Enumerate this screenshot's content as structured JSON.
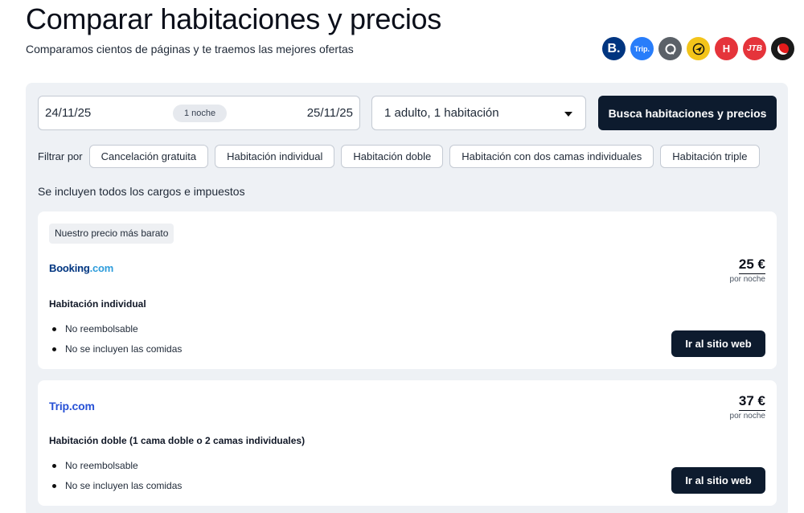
{
  "header": {
    "title": "Comparar habitaciones y precios",
    "subtitle": "Comparamos cientos de páginas y te traemos las mejores ofertas"
  },
  "partners": [
    {
      "name": "booking-logo-icon",
      "glyph": "B."
    },
    {
      "name": "trip-logo-icon",
      "glyph": "Trip."
    },
    {
      "name": "q-logo-icon",
      "glyph": "Q"
    },
    {
      "name": "plane-logo-icon",
      "glyph": "✈"
    },
    {
      "name": "h-logo-icon",
      "glyph": "H"
    },
    {
      "name": "jtb-logo-icon",
      "glyph": "JTB"
    },
    {
      "name": "dot-logo-icon",
      "glyph": ""
    }
  ],
  "search": {
    "date_start": "24/11/25",
    "nights": "1 noche",
    "date_end": "25/11/25",
    "guests": "1 adulto, 1 habitación",
    "button_label": "Busca habitaciones y precios"
  },
  "filters": {
    "label": "Filtrar por",
    "chips": [
      "Cancelación gratuita",
      "Habitación individual",
      "Habitación doble",
      "Habitación con dos camas individuales",
      "Habitación triple"
    ]
  },
  "tax_note": "Se incluyen todos los cargos e impuestos",
  "offers": [
    {
      "badge": "Nuestro precio más barato",
      "provider_main": "Booking",
      "provider_suffix": ".com",
      "price": "25 €",
      "price_unit": "por noche",
      "room": "Habitación individual",
      "features": [
        "No reembolsable",
        "No se incluyen las comidas"
      ],
      "button_label": "Ir al sitio web"
    },
    {
      "provider_main": "Trip.com",
      "price": "37 €",
      "price_unit": "por noche",
      "room": "Habitación doble (1 cama doble o 2 camas individuales)",
      "features": [
        "No reembolsable",
        "No se incluyen las comidas"
      ],
      "button_label": "Ir al sitio web"
    }
  ],
  "colors": {
    "primary_dark": "#0d1b2e",
    "panel_bg": "#eef1f5",
    "booking_blue": "#003580",
    "trip_blue": "#2852d6"
  }
}
